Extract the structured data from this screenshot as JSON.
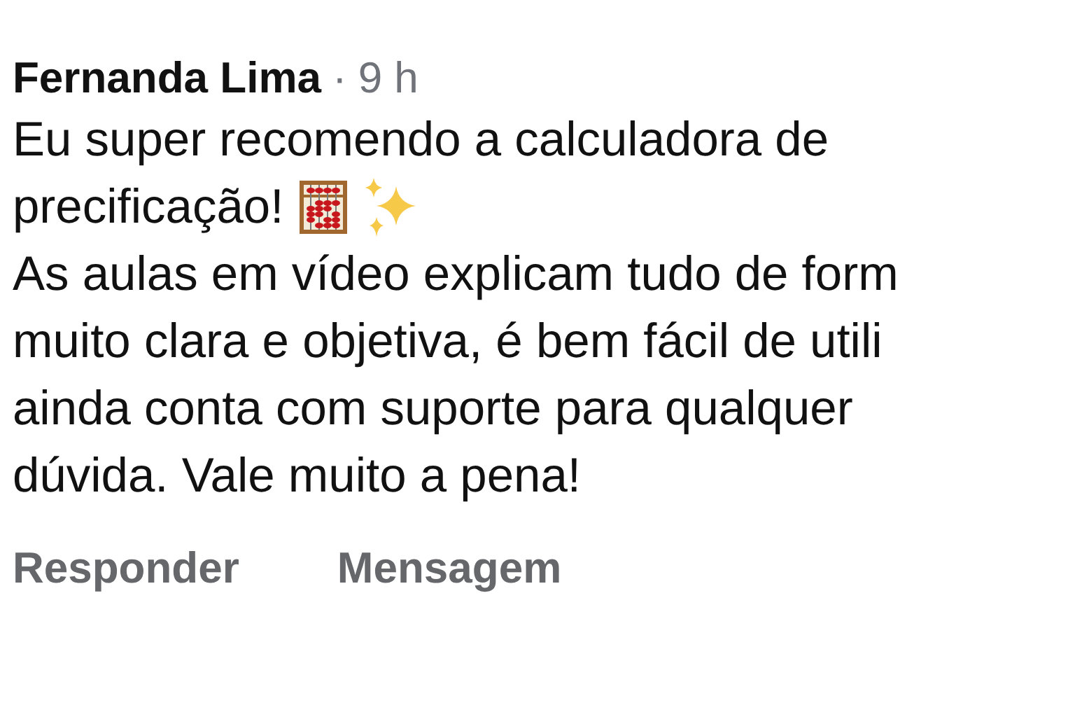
{
  "comment": {
    "author": "Fernanda Lima",
    "separator": "·",
    "time": "9 h",
    "lines": [
      {
        "kind": "plain",
        "text": "Eu super recomendo a calculadora de"
      },
      {
        "kind": "emoji",
        "text": "precificação!"
      },
      {
        "kind": "plain",
        "text": "As aulas em vídeo explicam tudo de form"
      },
      {
        "kind": "plain",
        "text": "muito clara e objetiva, é bem fácil de utili"
      },
      {
        "kind": "plain",
        "text": "ainda conta com suporte para qualquer"
      },
      {
        "kind": "plain",
        "text": "dúvida. Vale muito a pena!"
      }
    ],
    "actions": [
      "Responder",
      "Mensagem"
    ]
  }
}
